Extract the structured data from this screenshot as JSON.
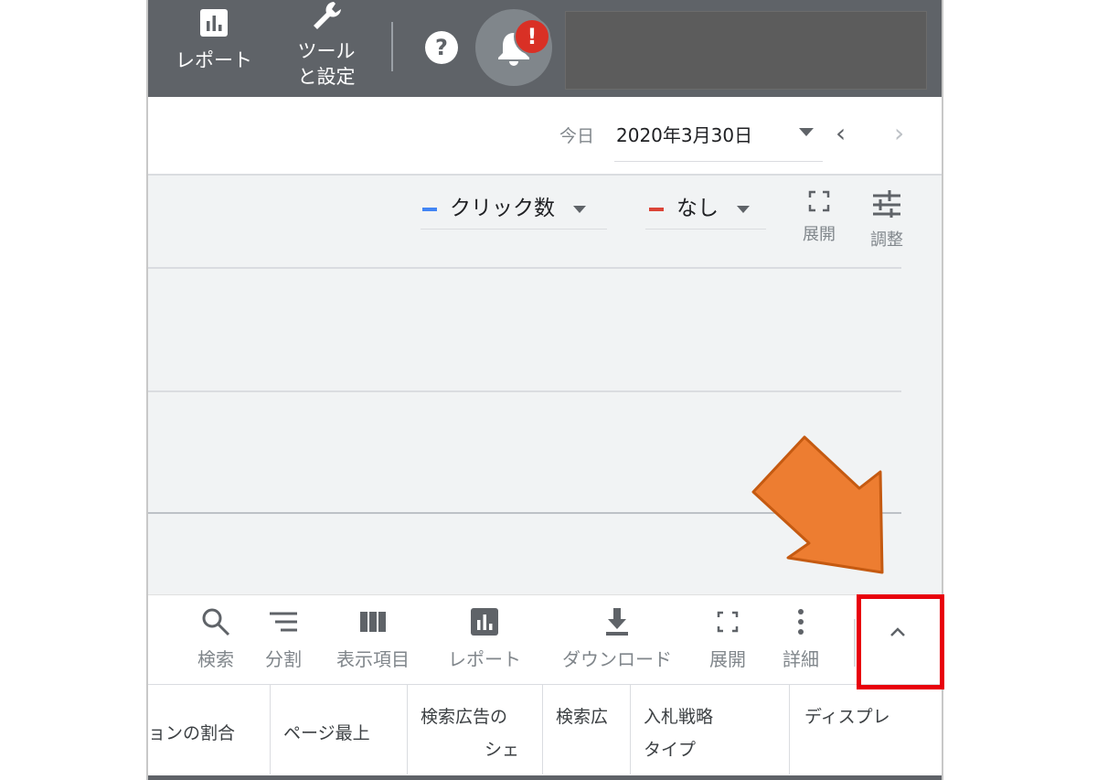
{
  "topbar": {
    "reports_label": "レポート",
    "tools_label_line1": "ツール",
    "tools_label_line2": "と設定",
    "help_glyph": "?",
    "alert_glyph": "!",
    "colors": {
      "bar": "#5f6368",
      "alert": "#d93025"
    }
  },
  "datebar": {
    "label": "今日",
    "value": "2020年3月30日",
    "prev_glyph": "‹",
    "next_glyph": "›"
  },
  "chart_controls": {
    "metric1": {
      "label": "クリック数",
      "color": "#4285f4"
    },
    "metric2": {
      "label": "なし",
      "color": "#db4437"
    },
    "expand_label": "展開",
    "adjust_label": "調整"
  },
  "toolbar": {
    "search": "検索",
    "segment": "分割",
    "columns": "表示項目",
    "reports": "レポート",
    "download": "ダウンロード",
    "expand": "展開",
    "details": "詳細"
  },
  "table_headers": [
    {
      "line1": "ョンの割合"
    },
    {
      "line1": "ページ最上"
    },
    {
      "line1": "検索広告の",
      "line2": "シェ"
    },
    {
      "line1": "検索広"
    },
    {
      "line1": "入札戦略",
      "line2": "タイプ"
    },
    {
      "line1": "ディスプレ"
    }
  ],
  "annotation": {
    "arrow_color": "#ed7d31",
    "highlight_color": "#e8000b"
  }
}
